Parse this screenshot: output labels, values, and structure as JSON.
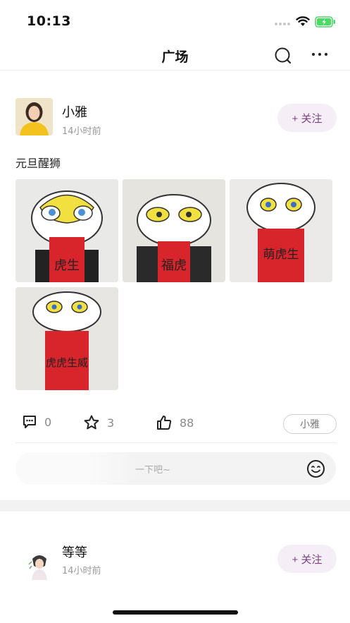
{
  "status_bar": {
    "time": "10:13",
    "battery_color": "#4cd964"
  },
  "nav": {
    "title": "广场",
    "search_icon": "search-icon",
    "more_icon": "more-icon"
  },
  "post": {
    "author": "小雅",
    "time_ago": "14小时前",
    "follow_label": "+ 关注",
    "text": "元旦醒狮",
    "photos": [
      {
        "caption": "虎生"
      },
      {
        "caption": "福虎"
      },
      {
        "caption": "萌虎生"
      },
      {
        "caption": "虎虎生威"
      }
    ],
    "comments_count": "0",
    "favorites_count": "3",
    "likes_count": "88",
    "tag": "小雅",
    "comment_placeholder": "一下吧~"
  },
  "post2": {
    "author": "等等",
    "time_ago": "14小时前",
    "follow_label": "+ 关注"
  },
  "colors": {
    "follow_bg": "#f5eef7",
    "follow_text": "#7b3f86",
    "banner_red": "#d8242b",
    "mask_yellow": "#f2e040"
  }
}
